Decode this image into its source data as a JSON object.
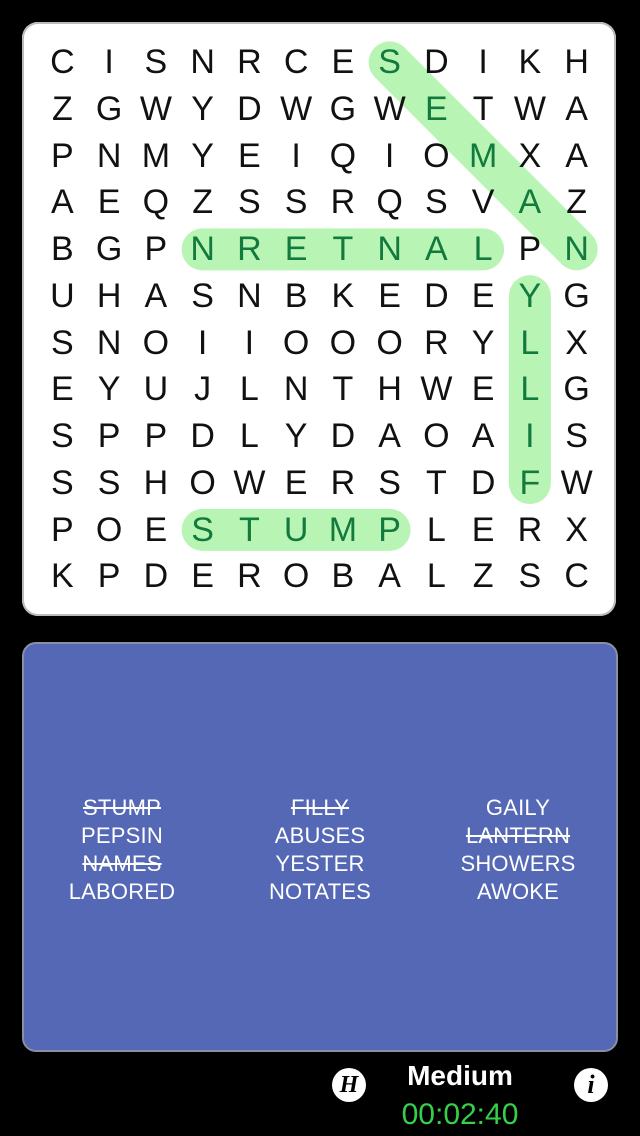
{
  "puzzle": {
    "grid": [
      "CISNRCESDIKH",
      "ZGWYDWGWETWA",
      "PNMYEIQIOMXA",
      "AEQZSSRQSVAZ",
      "BGPNRETNALPN",
      "UHASNBKEDEYG",
      "SNOIIOOORYLX",
      "EYUJLNTHWELG",
      "SPPDLYDAOAIS",
      "SSHOWERSTDFW",
      "POESTUMPLERX",
      "KPDEROBALZSC"
    ],
    "found": [
      {
        "word": "NAMES",
        "start": [
          0,
          7
        ],
        "end": [
          4,
          11
        ]
      },
      {
        "word": "LANTERN",
        "start": [
          4,
          9
        ],
        "end": [
          4,
          3
        ]
      },
      {
        "word": "FILLY",
        "start": [
          9,
          10
        ],
        "end": [
          5,
          10
        ]
      },
      {
        "word": "STUMP",
        "start": [
          10,
          3
        ],
        "end": [
          10,
          7
        ]
      }
    ],
    "highlight_color": "#b8f5b4",
    "found_letter_color": "#137a3d"
  },
  "word_list": {
    "columns": [
      [
        {
          "text": "STUMP",
          "found": true
        },
        {
          "text": "PEPSIN",
          "found": false
        },
        {
          "text": "NAMES",
          "found": true
        },
        {
          "text": "LABORED",
          "found": false
        }
      ],
      [
        {
          "text": "FILLY",
          "found": true
        },
        {
          "text": "ABUSES",
          "found": false
        },
        {
          "text": "YESTER",
          "found": false
        },
        {
          "text": "NOTATES",
          "found": false
        }
      ],
      [
        {
          "text": "GAILY",
          "found": false
        },
        {
          "text": "LANTERN",
          "found": true
        },
        {
          "text": "SHOWERS",
          "found": false
        },
        {
          "text": "AWOKE",
          "found": false
        }
      ]
    ],
    "panel_color": "#5468b5"
  },
  "footer": {
    "hint_icon": "H",
    "info_icon": "i",
    "difficulty": "Medium",
    "timer": "00:02:40",
    "timer_color": "#35d04a"
  }
}
